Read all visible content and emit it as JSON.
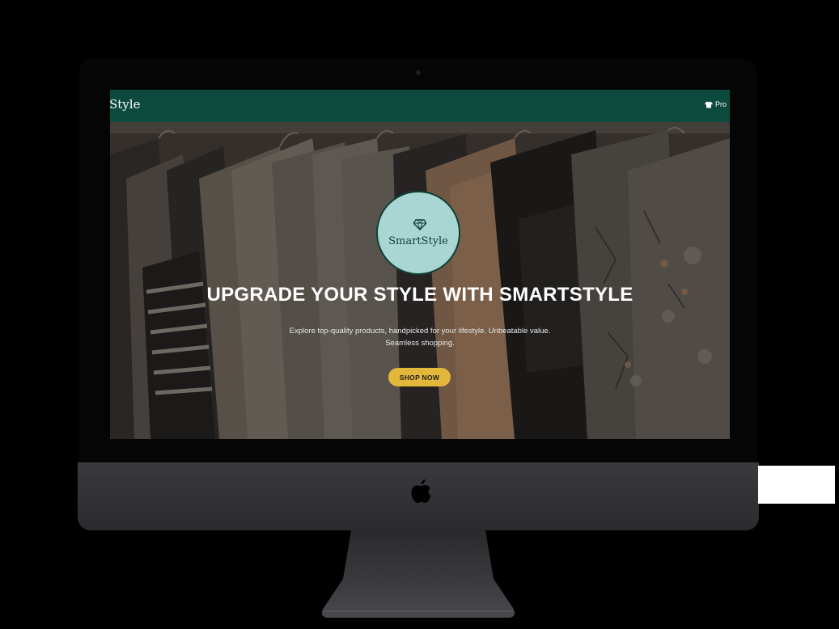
{
  "navbar": {
    "brand": "Style",
    "nav_item_label": "Pro",
    "nav_item_icon": "shirt-icon"
  },
  "hero": {
    "logo_text": "SmartStyle",
    "logo_icon": "diamond-icon",
    "headline": "UPGRADE YOUR STYLE WITH SMARTSTYLE",
    "subtext": "Explore top-quality products, handpicked for your lifestyle. Unbeatable value. Seamless shopping.",
    "cta_label": "SHOP NOW"
  },
  "device": {
    "logo_icon": "apple-icon"
  },
  "colors": {
    "navbar_bg": "#0b4a3c",
    "logo_circle_bg": "#a9d6d2",
    "cta_bg": "#e3b73a",
    "device_chin": "#333337"
  }
}
